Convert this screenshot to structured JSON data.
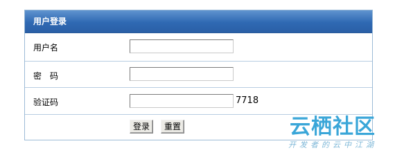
{
  "form": {
    "title": "用户登录",
    "username_label": "用户名",
    "username_value": "",
    "password_label": "密　码",
    "password_value": "",
    "captcha_label": "验证码",
    "captcha_value": "",
    "captcha_code": "7718",
    "login_button": "登录",
    "reset_button": "重置"
  },
  "watermark": {
    "main": "云栖社区",
    "sub": "开发者的云中江湖"
  },
  "colors": {
    "header_bg": "#2f69b3",
    "border": "#9bbad6",
    "watermark": "#3aa6d8"
  }
}
